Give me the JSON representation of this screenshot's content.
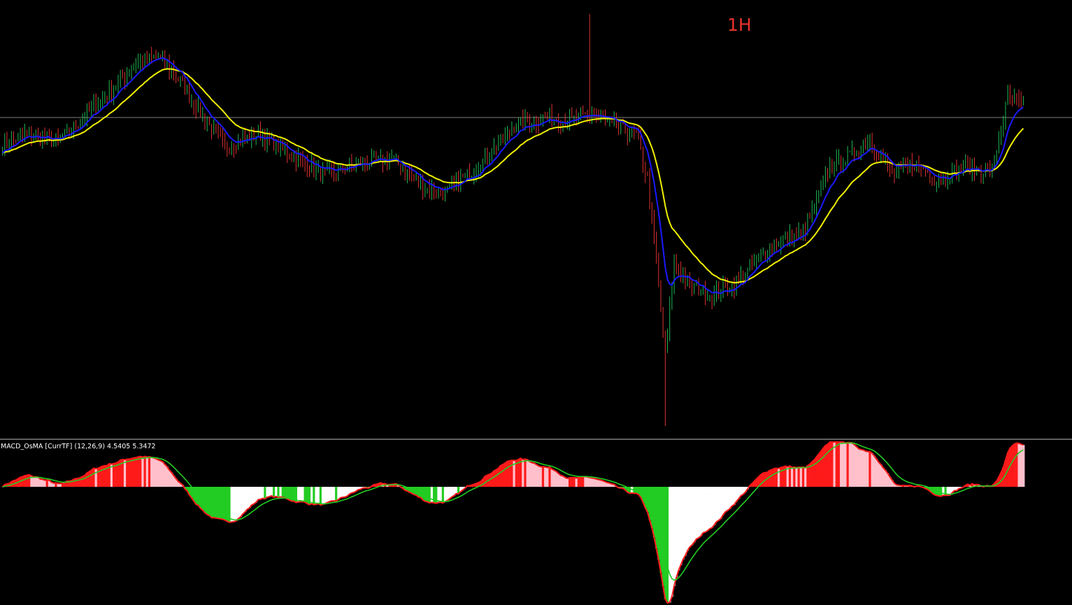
{
  "timeframe_label": "1H",
  "indicator_label": "MACD_OsMA [CurrTF] (12,26,9) 4.5405 5.3472",
  "colors": {
    "background": "#000000",
    "bull_candle": "#1db954",
    "bear_candle": "#e03030",
    "fast_ma": "#1a1aff",
    "slow_ma": "#f0f000",
    "price_line": "#808080",
    "separator": "#c0c0c0",
    "macd_up_strong": "#ff1a1a",
    "macd_up_weak": "#ffc0cb",
    "macd_down_strong": "#22cc22",
    "macd_down_weak": "#ffffff",
    "signal_red": "#ff1a1a",
    "signal_green": "#22cc22",
    "timeframe_text": "#e8322e",
    "indicator_text": "#ffffff"
  },
  "chart_data": [
    {
      "type": "candlestick",
      "title": "1H",
      "bar_count": 460,
      "ylim": [
        0,
        100
      ],
      "price_anchors": [
        [
          0,
          68
        ],
        [
          10,
          71
        ],
        [
          25,
          69
        ],
        [
          40,
          77
        ],
        [
          50,
          82
        ],
        [
          60,
          88
        ],
        [
          70,
          90
        ],
        [
          80,
          84
        ],
        [
          90,
          75
        ],
        [
          100,
          68
        ],
        [
          115,
          71
        ],
        [
          130,
          66
        ],
        [
          145,
          61
        ],
        [
          160,
          64
        ],
        [
          175,
          65
        ],
        [
          190,
          58
        ],
        [
          200,
          57
        ],
        [
          215,
          64
        ],
        [
          230,
          73
        ],
        [
          245,
          75
        ],
        [
          255,
          74
        ],
        [
          265,
          76
        ],
        [
          275,
          73
        ],
        [
          285,
          71
        ],
        [
          290,
          60
        ],
        [
          295,
          35
        ],
        [
          298,
          17
        ],
        [
          302,
          40
        ],
        [
          310,
          34
        ],
        [
          320,
          32
        ],
        [
          330,
          35
        ],
        [
          345,
          44
        ],
        [
          360,
          47
        ],
        [
          372,
          63
        ],
        [
          385,
          67
        ],
        [
          390,
          70
        ],
        [
          400,
          61
        ],
        [
          410,
          64
        ],
        [
          420,
          60
        ],
        [
          432,
          63
        ],
        [
          445,
          62
        ],
        [
          452,
          80
        ],
        [
          458,
          78
        ]
      ],
      "series": [
        {
          "name": "",
          "kind": "fast_ma",
          "period": 10
        },
        {
          "name": "",
          "kind": "slow_ma",
          "period": 25
        }
      ],
      "current_price": 75
    },
    {
      "type": "histogram",
      "title": "MACD_OsMA [CurrTF] (12,26,9) 4.5405 5.3472",
      "parameters": [
        12,
        26,
        9
      ],
      "values_shown": [
        4.5405,
        5.3472
      ],
      "zero_line": true
    }
  ]
}
